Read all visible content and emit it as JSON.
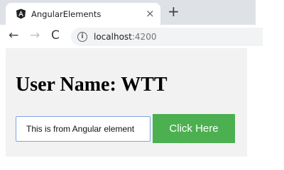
{
  "browser": {
    "tab": {
      "title": "AngularElements",
      "favicon": "angular-logo",
      "close_glyph": "×"
    },
    "new_tab_glyph": "+",
    "nav": {
      "back_glyph": "←",
      "forward_glyph": "→",
      "reload_glyph": "C"
    },
    "address": {
      "info_glyph": "i",
      "host": "localhost",
      "port": ":4200"
    }
  },
  "page": {
    "heading": "User Name: WTT",
    "input_value": "This is from Angular element",
    "button_label": "Click Here",
    "colors": {
      "button": "#4caf50",
      "input_border": "#7ea6e0",
      "background": "#f2f2f2"
    }
  }
}
